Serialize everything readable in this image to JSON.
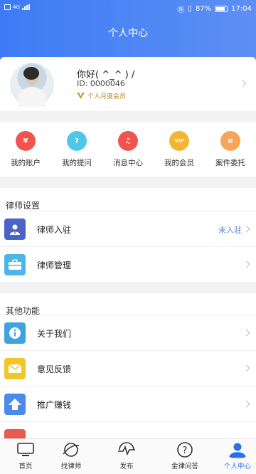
{
  "status_bar": {
    "carrier": "4G",
    "battery": "87%",
    "time": "17:04"
  },
  "header": {
    "title": "个人中心"
  },
  "profile": {
    "greeting": "你好( ^_^ ) /",
    "id": "ID: 0000046",
    "membership": "个人月度会员"
  },
  "quick_actions": [
    {
      "label": "我的账户",
      "icon": "yuan-icon",
      "color": "#f0544f",
      "glyph": "¥"
    },
    {
      "label": "我的提问",
      "icon": "question-icon",
      "color": "#4fc7e8",
      "glyph": "?"
    },
    {
      "label": "消息中心",
      "icon": "bell-icon",
      "color": "#f0544f",
      "glyph": "♫"
    },
    {
      "label": "我的会员",
      "icon": "vip-icon",
      "color": "#f3b533",
      "glyph": "VIP"
    },
    {
      "label": "案件委托",
      "icon": "document-icon",
      "color": "#f5a65a",
      "glyph": "≡"
    }
  ],
  "lawyer_settings": {
    "title": "律师设置",
    "items": [
      {
        "label": "律师入驻",
        "extra": "未入驻"
      },
      {
        "label": "律师管理",
        "extra": ""
      }
    ]
  },
  "other_functions": {
    "title": "其他功能",
    "items": [
      {
        "label": "关于我们"
      },
      {
        "label": "意见反馈"
      },
      {
        "label": "推广赚钱"
      }
    ]
  },
  "tabbar": [
    {
      "label": "首页",
      "icon": "tv-icon"
    },
    {
      "label": "找律师",
      "icon": "planet-icon"
    },
    {
      "label": "发布",
      "icon": "pulse-icon"
    },
    {
      "label": "金律问答",
      "icon": "question-circle-icon"
    },
    {
      "label": "个人中心",
      "icon": "person-icon",
      "active": true
    }
  ]
}
